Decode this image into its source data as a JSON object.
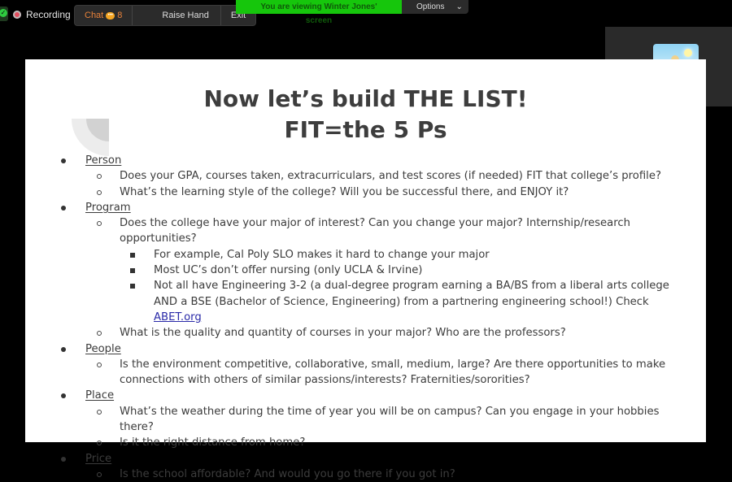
{
  "meeting_toolbar": {
    "recording_label": "Recording",
    "chat_label": "Chat",
    "chat_count": "8",
    "raise_hand_label": "Raise Hand",
    "exit_label": "Exit"
  },
  "share_banner": {
    "viewing_text": "You are viewing Winter Jones' screen",
    "options_label": "Options",
    "banner_color": "#16c60c"
  },
  "participant": {
    "name": "Winter Jones"
  },
  "slide": {
    "title_line1": "Now let’s build THE LIST!",
    "title_line2": "FIT=the 5 Ps",
    "sections": [
      {
        "heading": "Person",
        "items": [
          {
            "text": "Does your GPA, courses taken, extracurriculars, and test scores (if needed) FIT that college’s profile?"
          },
          {
            "text": "What’s the learning style of the college? Will you be successful there, and ENJOY it?"
          }
        ]
      },
      {
        "heading": "Program",
        "items": [
          {
            "text": "Does the college have your major of interest? Can you change your major? Internship/research opportunities?",
            "subitems": [
              "For example, Cal Poly SLO makes it hard to change your major",
              "Most UC’s don’t offer nursing (only UCLA & Irvine)",
              "Not all have Engineering 3-2 (a dual-degree program earning a BA/BS from a liberal arts college AND a BSE (Bachelor of Science, Engineering) from a partnering engineering school!) Check"
            ],
            "link_text": "ABET.org"
          },
          {
            "text": "What is the quality and quantity of courses in your major? Who are the professors?"
          }
        ]
      },
      {
        "heading": "People",
        "items": [
          {
            "text": "Is the environment competitive, collaborative, small, medium, large? Are there opportunities to make connections with others of similar passions/interests? Fraternities/sororities?"
          }
        ]
      },
      {
        "heading": "Place",
        "items": [
          {
            "text": "What’s the weather during the time of year you will be on campus? Can you engage in your hobbies there?"
          },
          {
            "text": "Is it the right distance from home?"
          }
        ]
      },
      {
        "heading": "Price",
        "items": [
          {
            "text": "Is the school affordable? And would you go there if you got in?"
          }
        ]
      }
    ]
  }
}
